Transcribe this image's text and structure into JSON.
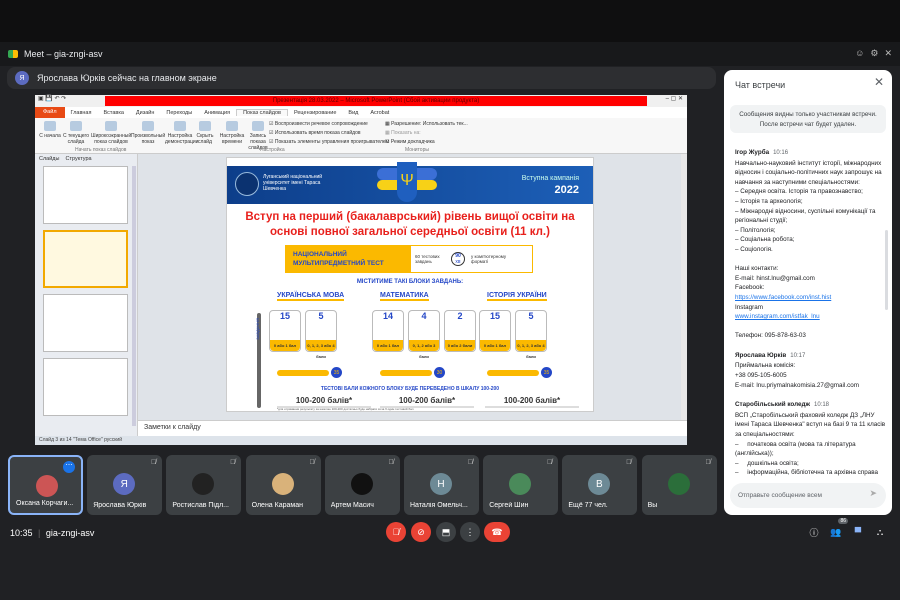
{
  "window": {
    "title": "Meet – gia-zngi-asv",
    "icons": [
      "emoji-icon",
      "settings-icon",
      "close-icon"
    ]
  },
  "banner": {
    "avatar": "Я",
    "text": "Ярослава Юрків сейчас на главном экране"
  },
  "ppt": {
    "title": "Презентація 28.03.2022 – Microsoft PowerPoint (Сбой активации продукта)",
    "tabs": [
      "Файл",
      "Главная",
      "Вставка",
      "Дизайн",
      "Переходы",
      "Анимация",
      "Показ слайдов",
      "Рецензирование",
      "Вид",
      "Acrobat"
    ],
    "active_tab": "Показ слайдов",
    "ribbon": {
      "b1": "С начала",
      "b2": "С текущего слайда",
      "b3": "Широкоэкранный показ слайдов",
      "b4": "Произвольный показ",
      "g1": "Начать показ слайдов",
      "b5": "Настройка демонстрации",
      "b6": "Скрыть слайд",
      "b7": "Настройка времени",
      "b8": "Запись показа слайдов",
      "c1": "Воспроизвести речевое сопровождение",
      "c2": "Использовать время показа слайдов",
      "c3": "Показать элементы управления проигрывателем",
      "g2": "Настройка",
      "r1": "Разрешение: Использовать тек...",
      "r2": "Показать на:",
      "r3": "Режим докладчика",
      "g3": "Мониторы"
    },
    "pane_tabs": [
      "Слайды",
      "Структура"
    ],
    "notes_placeholder": "Заметки к слайду",
    "status": "Слайд 3 из 14   \"Тема Office\"   русский",
    "slide": {
      "uni": "Луганський національний університет імені Тараса Шевченка",
      "campaign": "Вступна кампанія",
      "year": "2022",
      "headline1": "Вступ на перший (бакалаврський) рівень вищої освіти на",
      "headline2": "основі повної загальної середньої освіти (11 кл.)",
      "nmt": "НАЦІОНАЛЬНИЙ МУЛЬТИПРЕДМЕТНИЙ ТЕСТ",
      "tasks": "60 тестових завдань",
      "minutes": "90",
      "minutes_unit": "хв",
      "format": "у комп'ютерному форматі",
      "blocks_title": "МІСТИТИМЕ ТАКІ БЛОКИ ЗАВДАНЬ:",
      "side_label": "ЗАВДАННЯ",
      "subjects": [
        {
          "name": "УКРАЇНСЬКА МОВА",
          "cards": [
            {
              "n": "15",
              "b": "0 або 1 бал"
            },
            {
              "n": "5",
              "b": "0, 1, 2, 3 або 4 бали"
            }
          ],
          "max": "35"
        },
        {
          "name": "МАТЕМАТИКА",
          "cards": [
            {
              "n": "14",
              "b": "0 або 1 бал"
            },
            {
              "n": "4",
              "b": "0, 1, 2 або 3 бали"
            },
            {
              "n": "2",
              "b": "0 або 2 бали"
            }
          ],
          "max": "30"
        },
        {
          "name": "ІСТОРІЯ УКРАЇНИ",
          "cards": [
            {
              "n": "15",
              "b": "0 або 1 бал"
            },
            {
              "n": "5",
              "b": "0, 1, 2, 3 або 4 бали"
            }
          ],
          "max": "35"
        }
      ],
      "scale_note": "ТЕСТОВІ БАЛИ КОЖНОГО БЛОКУ БУДЕ ПЕРЕВЕДЕНО В ШКАЛУ 100-200",
      "score": "100-200 балів*",
      "footnote": "*для отримання результату за шкалою 100-200 достатньо буде набрати хоча б один тестовий бал"
    }
  },
  "chat": {
    "title": "Чат встречи",
    "notice": "Сообщения видны только участникам встречи. После встречи чат будет удален.",
    "messages": [
      {
        "author": "Ігор Журба",
        "time": "10:16",
        "text": "Навчально-науковий інститут історії, міжнародних відносин і соціально-політичних наук запрошує на навчання за наступними спеціальностями:\n– Середня освіта. Історія та правознавство;\n– Історія та археологія;\n– Міжнародні відносини, суспільні комунікації та регіональні студії;\n– Політологія;\n– Соціальна робота;\n– Соціологія.\n\nНаші контакти:\nE-mail: hinst.lnu@gmail.com\nFacebook:",
        "link1": "https://www.facebook.com/inst.hist",
        "text2": "Instagram",
        "link2": "www.instagram.com/istfak_lnu",
        "text3": "\nТелефон: 095-878-63-03"
      },
      {
        "author": "Ярослава Юрків",
        "time": "10:17",
        "text": "Приймальна комісія:\n+38 095-105-6005\nE-mail: lnu.priymalnakomisia.27@gmail.com"
      },
      {
        "author": "Старобільський коледж",
        "time": "10:18",
        "text": "ВСП „Старобільський фаховий коледж ДЗ „ЛНУ імені Тараса Шевченка\" вступ на базі 9 та 11 класів за спеціальностями:\n–     початкова освіта (мова та література (англійська));\n–     дошкільна освіта;\n–     інформаційна, бібліотечна та архівна справа"
      }
    ],
    "input_placeholder": "Отправьте сообщение всем"
  },
  "participants": [
    {
      "name": "Оксана Корчаги...",
      "initial": "",
      "color": "#c55",
      "active": true
    },
    {
      "name": "Ярослава Юрків",
      "initial": "Я",
      "color": "#5c6bc0"
    },
    {
      "name": "Ростислав Підл...",
      "initial": "",
      "color": "#222"
    },
    {
      "name": "Олена Караман",
      "initial": "",
      "color": "#d9b27a"
    },
    {
      "name": "Артем Масич",
      "initial": "",
      "color": "#111"
    },
    {
      "name": "Наталія Омельч...",
      "initial": "Н",
      "color": "#6d8a96"
    },
    {
      "name": "Сергей Шин",
      "initial": "",
      "color": "#4a8a5a"
    },
    {
      "name": "Ещё 77 чел.",
      "initial": "В",
      "color": "#6d8a96"
    },
    {
      "name": "Вы",
      "initial": "",
      "color": "#2b6e3a"
    }
  ],
  "bottom": {
    "time": "10:35",
    "meeting_code": "gia-zngi-asv",
    "people_count": "86"
  },
  "colors": {
    "end_call": "#ea4335",
    "accent": "#8ab4f8"
  }
}
